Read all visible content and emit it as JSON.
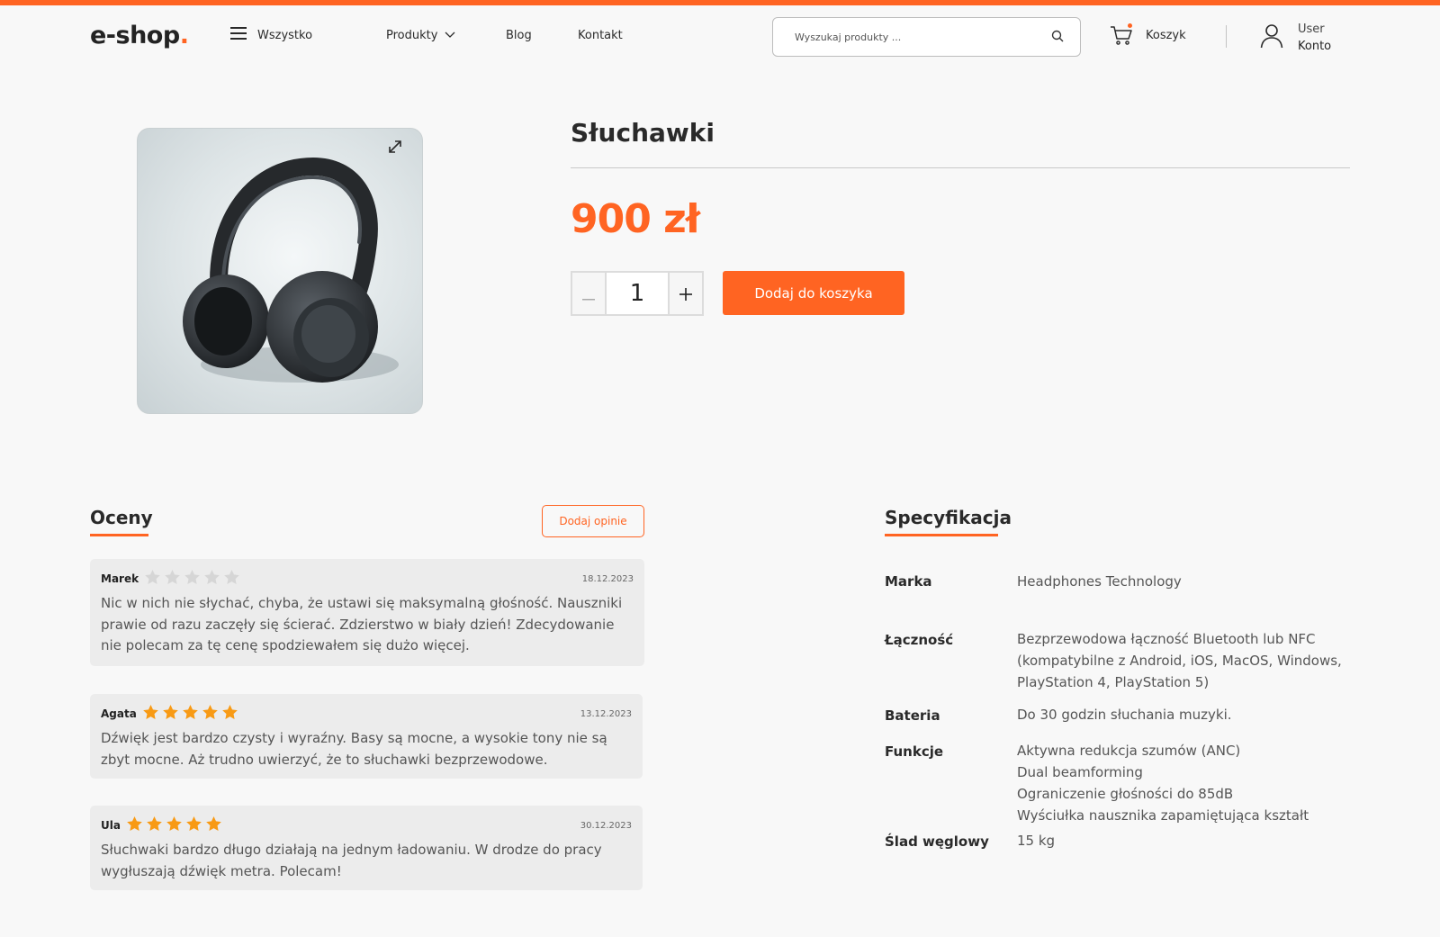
{
  "header": {
    "logo_text": "e-shop",
    "logo_dot": ".",
    "menu_all_label": "Wszystko",
    "nav": {
      "products": "Produkty",
      "blog": "Blog",
      "contact": "Kontakt"
    },
    "search_placeholder": "Wyszukaj produkty ...",
    "cart_label": "Koszyk",
    "account_user": "User",
    "account_label": "Konto"
  },
  "product": {
    "title": "Słuchawki",
    "price": "900 zł",
    "quantity": "1",
    "add_to_cart_label": "Dodaj do koszyka",
    "image_alt": "headphones"
  },
  "reviews": {
    "title": "Oceny",
    "add_review_label": "Dodaj opinie",
    "items": [
      {
        "author": "Marek",
        "rating": 0,
        "date": "18.12.2023",
        "text": "Nic w nich nie słychać, chyba, że ustawi się maksymalną głośność. Nauszniki prawie od razu zaczęły się ścierać. Zdzierstwo w biały dzień! Zdecydowanie nie polecam za tę cenę spodziewałem się dużo więcej."
      },
      {
        "author": "Agata",
        "rating": 5,
        "date": "13.12.2023",
        "text": "Dźwięk jest bardzo czysty i wyraźny. Basy są mocne, a wysokie tony nie są zbyt mocne. Aż trudno uwierzyć, że to słuchawki bezprzewodowe."
      },
      {
        "author": "Ula",
        "rating": 5,
        "date": "30.12.2023",
        "text": "Słuchwaki bardzo długo działają na jednym ładowaniu. W drodze do pracy wygłuszają dźwięk metra. Polecam!"
      }
    ]
  },
  "specs": {
    "title": "Specyfikacja",
    "rows": [
      {
        "label": "Marka",
        "value": "Headphones Technology"
      },
      {
        "label": "Łączność",
        "value": "Bezprzewodowa łączność Bluetooth lub NFC\n(kompatybilne z Android, iOS, MacOS, Windows,\nPlayStation 4, PlayStation 5)"
      },
      {
        "label": "Bateria",
        "value": "Do 30 godzin słuchania muzyki."
      },
      {
        "label": "Funkcje",
        "value": "Aktywna redukcja szumów (ANC)\nDual beamforming\nOgraniczenie głośności do 85dB\nWyściułka nausznika zapamiętująca kształt"
      },
      {
        "label": "Ślad węglowy",
        "value": "15 kg"
      }
    ]
  },
  "colors": {
    "accent": "#ff6422",
    "star_filled": "#f89a14",
    "star_empty": "#d6d6d6"
  },
  "icons": [
    "hamburger-icon",
    "chevron-down-icon",
    "search-icon",
    "cart-icon",
    "user-icon",
    "expand-icon",
    "star-icon"
  ]
}
